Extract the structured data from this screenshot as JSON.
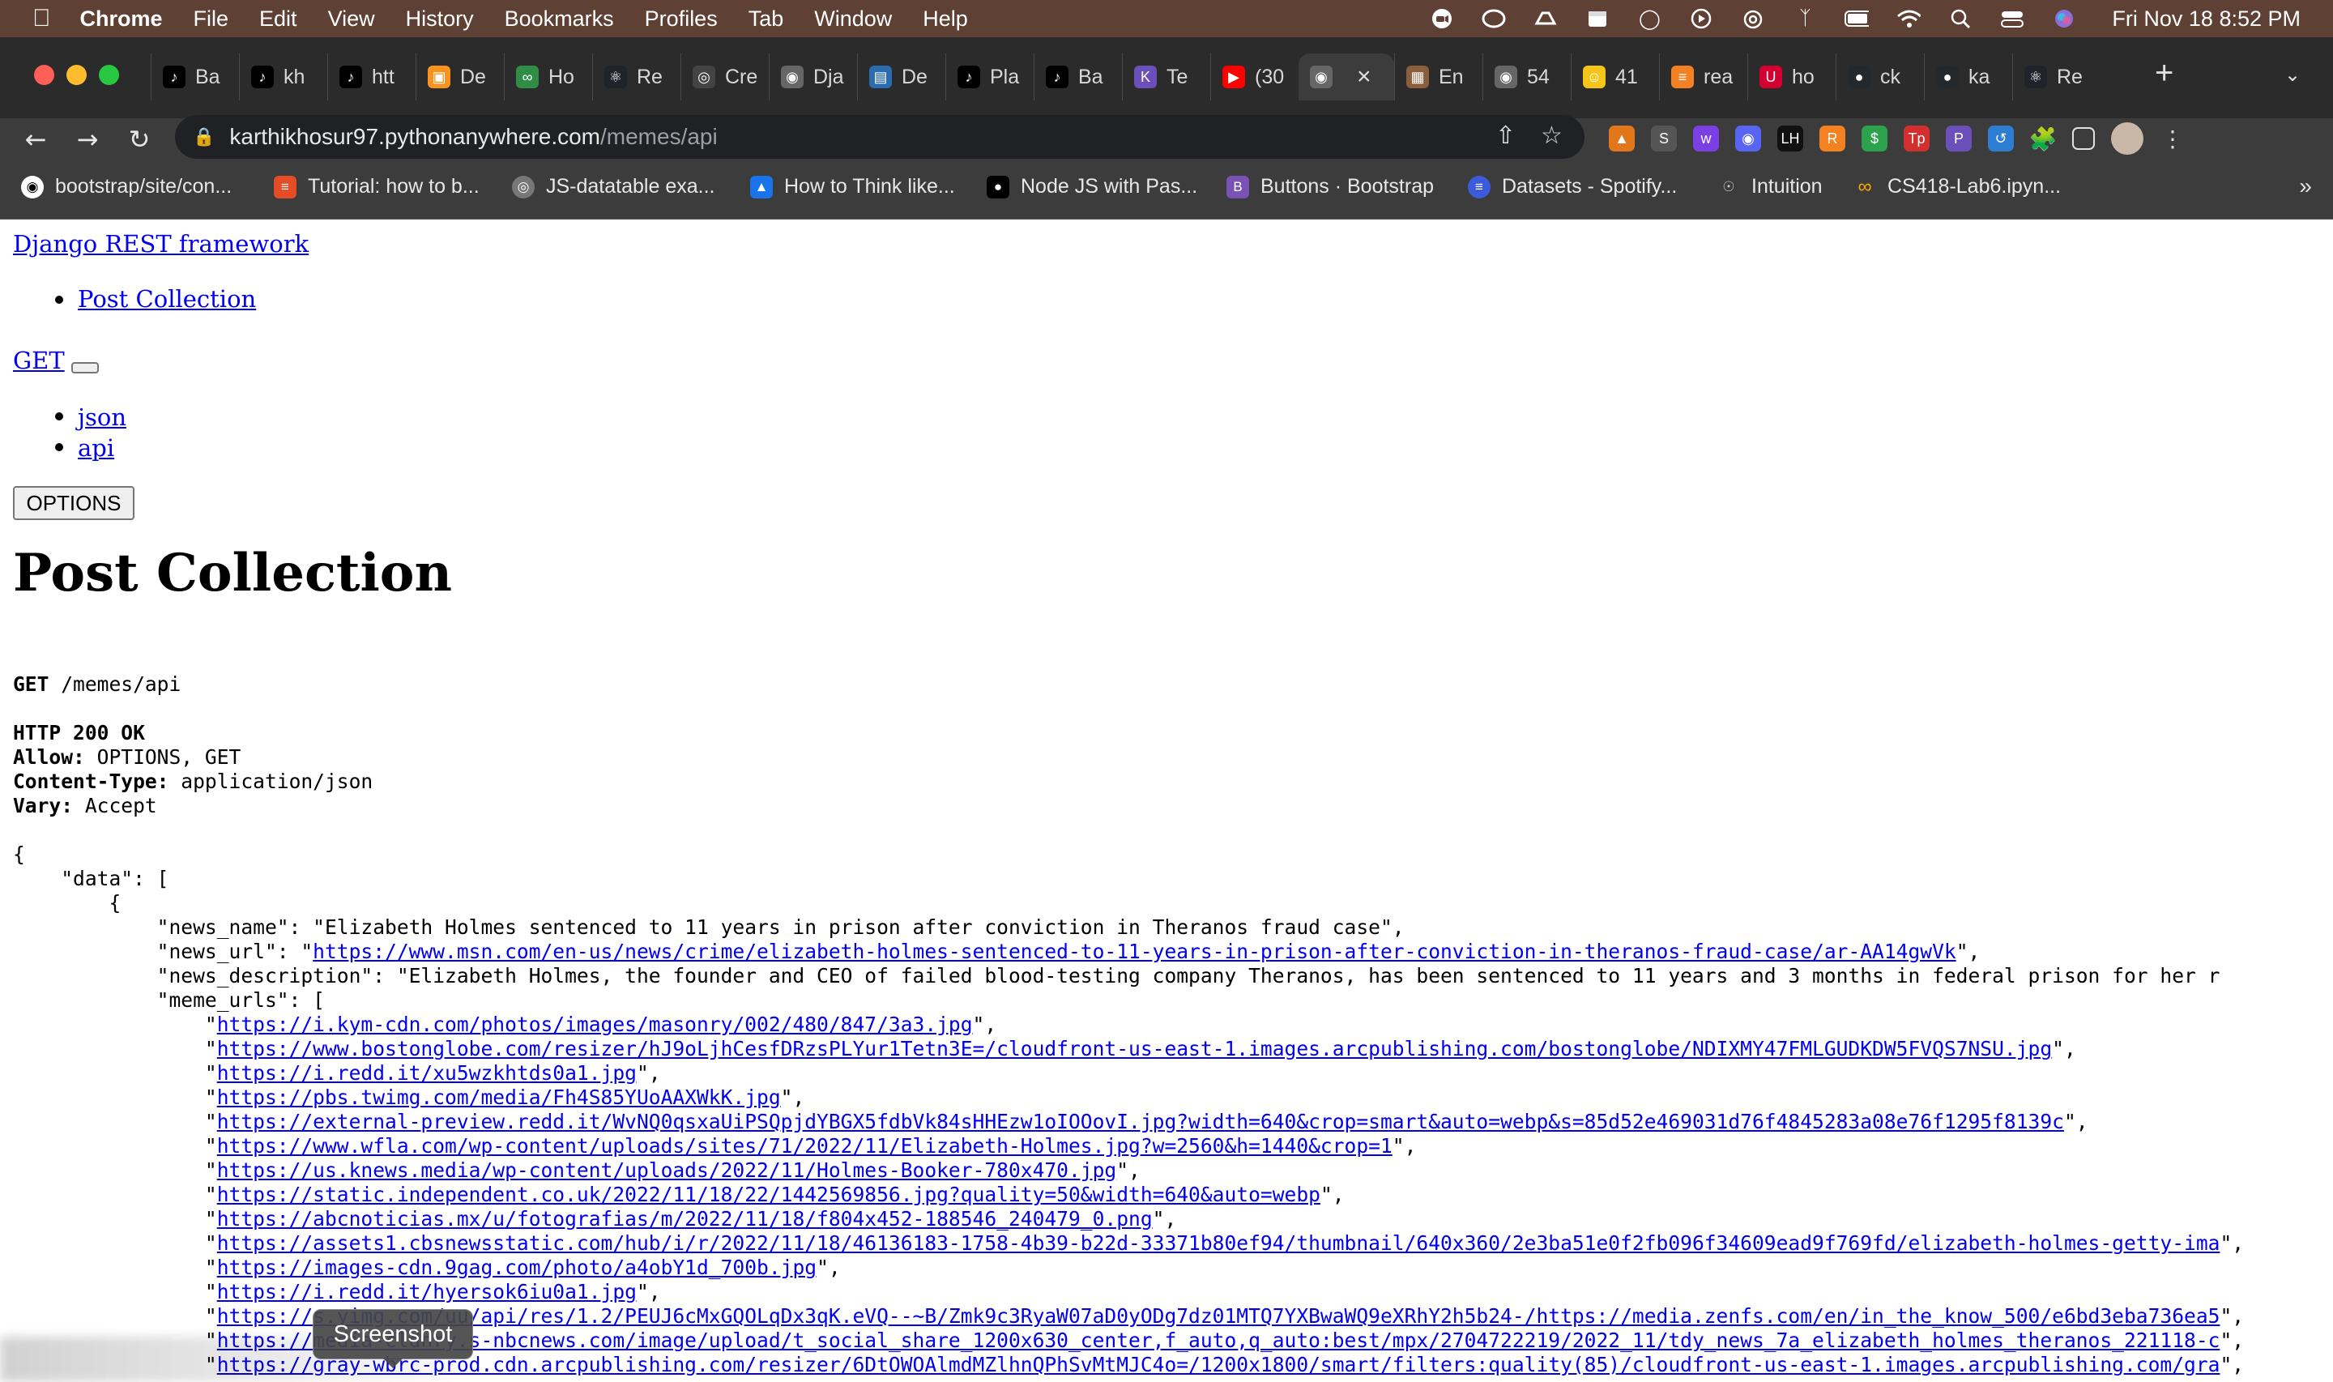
{
  "menubar": {
    "app_name": "Chrome",
    "items": [
      "File",
      "Edit",
      "View",
      "History",
      "Bookmarks",
      "Profiles",
      "Tab",
      "Window",
      "Help"
    ],
    "clock": "Fri Nov 18  8:52 PM"
  },
  "tabs": [
    {
      "label": "Ba",
      "icon": "tiktok-icon"
    },
    {
      "label": "kh",
      "icon": "tiktok-icon"
    },
    {
      "label": "htt",
      "icon": "tiktok-icon"
    },
    {
      "label": "De",
      "icon": "dev-icon"
    },
    {
      "label": "Ho",
      "icon": "geeks-icon"
    },
    {
      "label": "Re",
      "icon": "react-icon"
    },
    {
      "label": "Cre",
      "icon": "circle-icon"
    },
    {
      "label": "Dja",
      "icon": "globe-icon"
    },
    {
      "label": "De",
      "icon": "book-icon"
    },
    {
      "label": "Pla",
      "icon": "tiktok-icon"
    },
    {
      "label": "Ba",
      "icon": "tiktok-icon"
    },
    {
      "label": "Te",
      "icon": "k-icon"
    },
    {
      "label": "(30",
      "icon": "youtube-icon"
    },
    {
      "label": "",
      "icon": "globe-icon",
      "active": true
    },
    {
      "label": "En",
      "icon": "image-icon"
    },
    {
      "label": "54",
      "icon": "globe-icon"
    },
    {
      "label": "41",
      "icon": "emoji-icon"
    },
    {
      "label": "rea",
      "icon": "stack-icon"
    },
    {
      "label": "ho",
      "icon": "uic-icon"
    },
    {
      "label": "ck",
      "icon": "github-icon"
    },
    {
      "label": "ka",
      "icon": "github-icon"
    },
    {
      "label": "Re",
      "icon": "react-icon"
    }
  ],
  "omnibox": {
    "host": "karthikhosur97.pythonanywhere.com",
    "path": "/memes/api"
  },
  "bookmarks": [
    "bootstrap/site/con...",
    "Tutorial: how to b...",
    "JS-datatable exa...",
    "How to Think like...",
    "Node JS with Pas...",
    "Buttons · Bootstrap",
    "Datasets - Spotify...",
    "Intuition",
    "CS418-Lab6.ipyn..."
  ],
  "page": {
    "brand": "Django REST framework",
    "breadcrumb": "Post Collection",
    "get_label": "GET",
    "formats": [
      "json",
      "api"
    ],
    "options_label": "OPTIONS",
    "title": "Post Collection",
    "request_method": "GET",
    "request_path": " /memes/api",
    "status": "HTTP 200 OK",
    "headers": [
      {
        "name": "Allow:",
        "value": " OPTIONS, GET"
      },
      {
        "name": "Content-Type:",
        "value": " application/json"
      },
      {
        "name": "Vary:",
        "value": " Accept"
      }
    ],
    "json_open": "{",
    "data_key_line": "    \"data\": [",
    "obj_open": "        {",
    "news_name_line": "            \"news_name\": \"Elizabeth Holmes sentenced to 11 years in prison after conviction in Theranos fraud case\",",
    "news_url_prefix": "            \"news_url\": \"",
    "news_url": "https://www.msn.com/en-us/news/crime/elizabeth-holmes-sentenced-to-11-years-in-prison-after-conviction-in-theranos-fraud-case/ar-AA14gwVk",
    "news_url_suffix": "\",",
    "news_description_line": "            \"news_description\": \"Elizabeth Holmes, the founder and CEO of failed blood-testing company Theranos, has been sentenced to 11 years and 3 months in federal prison for her r",
    "meme_urls_line": "            \"meme_urls\": [",
    "meme_urls": [
      "https://i.kym-cdn.com/photos/images/masonry/002/480/847/3a3.jpg",
      "https://www.bostonglobe.com/resizer/hJ9oLjhCesfDRzsPLYur1Tetn3E=/cloudfront-us-east-1.images.arcpublishing.com/bostonglobe/NDIXMY47FMLGUDKDW5FVQS7NSU.jpg",
      "https://i.redd.it/xu5wzkhtds0a1.jpg",
      "https://pbs.twimg.com/media/Fh4S85YUoAAXWkK.jpg",
      "https://external-preview.redd.it/WvNQ0qsxaUiPSQpjdYBGX5fdbVk84sHHEzw1oIOOovI.jpg?width=640&crop=smart&auto=webp&s=85d52e469031d76f4845283a08e76f1295f8139c",
      "https://www.wfla.com/wp-content/uploads/sites/71/2022/11/Elizabeth-Holmes.jpg?w=2560&h=1440&crop=1",
      "https://us.knews.media/wp-content/uploads/2022/11/Holmes-Booker-780x470.jpg",
      "https://static.independent.co.uk/2022/11/18/22/1442569856.jpg?quality=50&width=640&auto=webp",
      "https://abcnoticias.mx/u/fotografias/m/2022/11/18/f804x452-188546_240479_0.png",
      "https://assets1.cbsnewsstatic.com/hub/i/r/2022/11/18/46136183-1758-4b39-b22d-33371b80ef94/thumbnail/640x360/2e3ba51e0f2fb096f34609ead9f769fd/elizabeth-holmes-getty-ima",
      "https://images-cdn.9gag.com/photo/a4obY1d_700b.jpg",
      "https://i.redd.it/hyersok6iu0a1.jpg",
      "https://s.yimg.com/uu/api/res/1.2/PEUJ6cMxGQOLqDx3qK.eVQ--~B/Zmk9c3RyaW07aD0yODg7dz01MTQ7YXBwaWQ9eXRhY2h5b24-/https://media.zenfs.com/en/in_the_know_500/e6bd3eba736ea5",
      "https://media-cldnry.s-nbcnews.com/image/upload/t_social_share_1200x630_center,f_auto,q_auto:best/mpx/2704722219/2022_11/tdy_news_7a_elizabeth_holmes_theranos_221118-c",
      "https://gray-wbrc-prod.cdn.arcpublishing.com/resizer/6DtOWOAlmdMZlhnQPhSvMtMJC4o=/1200x1800/smart/filters:quality(85)/cloudfront-us-east-1.images.arcpublishing.com/gra"
    ],
    "meme_url_indent": "                \"",
    "meme_url_tail": "\","
  },
  "tooltip": "Screenshot"
}
